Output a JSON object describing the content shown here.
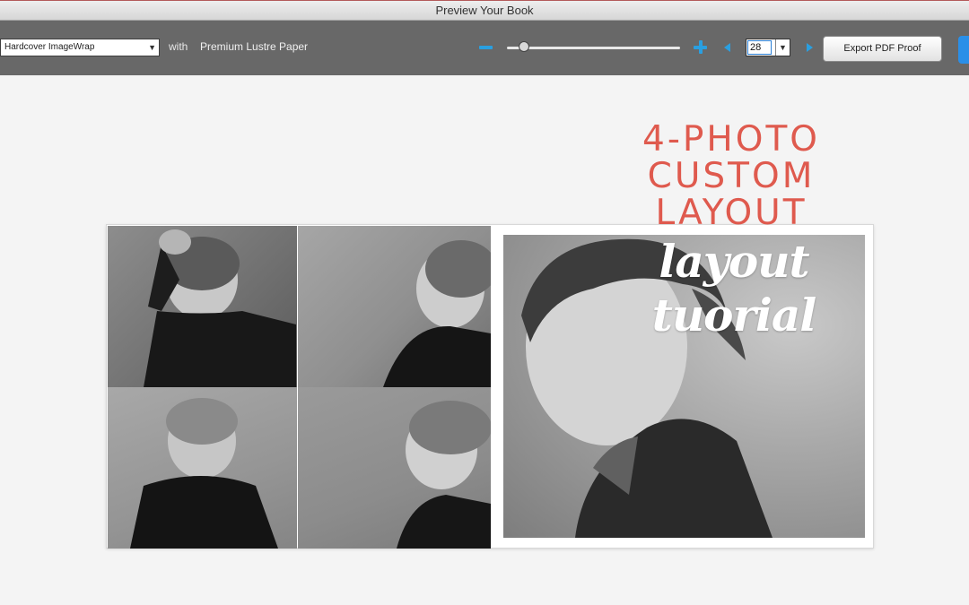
{
  "window": {
    "title": "Preview Your Book"
  },
  "toolbar": {
    "cover_option": "Hardcover ImageWrap",
    "with_label": "with",
    "paper_option": "Premium Lustre Paper",
    "page_number": "28",
    "export_label": "Export PDF Proof",
    "zoom_level": 0.1
  },
  "overlay": {
    "headline": [
      "4-PHOTO",
      "CUSTOM",
      "LAYOUT"
    ],
    "subtitle": "layout tuorial"
  },
  "spread": {
    "photos": [
      "child-photo-1",
      "child-photo-2",
      "child-photo-3",
      "child-photo-4",
      "child-photo-large"
    ]
  },
  "colors": {
    "accent": "#2a9fe0",
    "headline": "#df5a4e",
    "toolbar": "#686868"
  }
}
